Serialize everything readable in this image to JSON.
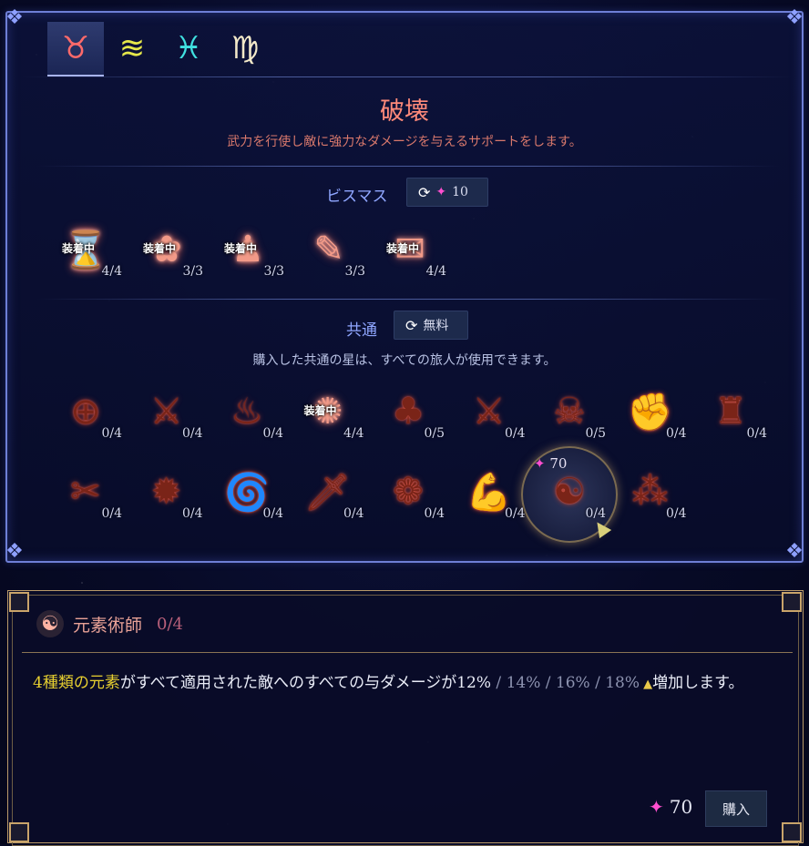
{
  "tabs": [
    {
      "symbol": "♉",
      "color": "#ff6a6a",
      "active": true
    },
    {
      "symbol": "≋",
      "color": "#e6e84a",
      "active": false
    },
    {
      "symbol": "♓",
      "color": "#40e0e0",
      "active": false
    },
    {
      "symbol": "♍",
      "color": "#f3e9c9",
      "active": false
    }
  ],
  "header": {
    "title": "破壊",
    "subtitle": "武力を行使し敵に強力なダメージを与えるサポートをします。"
  },
  "bismuth": {
    "label": "ビスマス",
    "refresh_cost": "10",
    "slots": [
      {
        "icon": "⌛",
        "level": "4/4",
        "equipped": "装着中"
      },
      {
        "icon": "✿",
        "level": "3/3",
        "equipped": "装着中"
      },
      {
        "icon": "♟",
        "level": "3/3",
        "equipped": "装着中"
      },
      {
        "icon": "✎",
        "level": "3/3",
        "equipped": ""
      },
      {
        "icon": "✉",
        "level": "4/4",
        "equipped": "装着中"
      }
    ]
  },
  "common": {
    "label": "共通",
    "refresh_label": "無料",
    "note": "購入した共通の星は、すべての旅人が使用できます。",
    "row1": [
      {
        "icon": "⊕",
        "level": "0/4",
        "equipped": ""
      },
      {
        "icon": "⚔",
        "level": "0/4",
        "equipped": ""
      },
      {
        "icon": "♨",
        "level": "0/4",
        "equipped": ""
      },
      {
        "icon": "✺",
        "level": "4/4",
        "equipped": "装着中"
      },
      {
        "icon": "♣",
        "level": "0/5",
        "equipped": ""
      },
      {
        "icon": "⚔",
        "level": "0/4",
        "equipped": ""
      },
      {
        "icon": "☠",
        "level": "0/5",
        "equipped": ""
      },
      {
        "icon": "✊",
        "level": "0/4",
        "equipped": ""
      },
      {
        "icon": "♜",
        "level": "0/4",
        "equipped": ""
      }
    ],
    "row2": [
      {
        "icon": "✂",
        "level": "0/4",
        "equipped": ""
      },
      {
        "icon": "✹",
        "level": "0/4",
        "equipped": ""
      },
      {
        "icon": "🌀",
        "level": "0/4",
        "equipped": ""
      },
      {
        "icon": "🗡",
        "level": "0/4",
        "equipped": ""
      },
      {
        "icon": "❁",
        "level": "0/4",
        "equipped": ""
      },
      {
        "icon": "💪",
        "level": "0/4",
        "equipped": ""
      },
      {
        "icon": "☯",
        "level": "0/4",
        "equipped": ""
      },
      {
        "icon": "⁂",
        "level": "0/4",
        "equipped": ""
      }
    ],
    "selected_price": "70"
  },
  "detail": {
    "icon": "☯",
    "name": "元素術師",
    "level": "0/4",
    "desc_keyword": "4種類の元素",
    "desc_main": "がすべて適用された敵へのすべての与ダメージが12%",
    "desc_tiers": " / 14% / 16% / 18%",
    "desc_up": " ▲",
    "desc_end": "増加します。",
    "price": "70",
    "buy_label": "購入"
  }
}
